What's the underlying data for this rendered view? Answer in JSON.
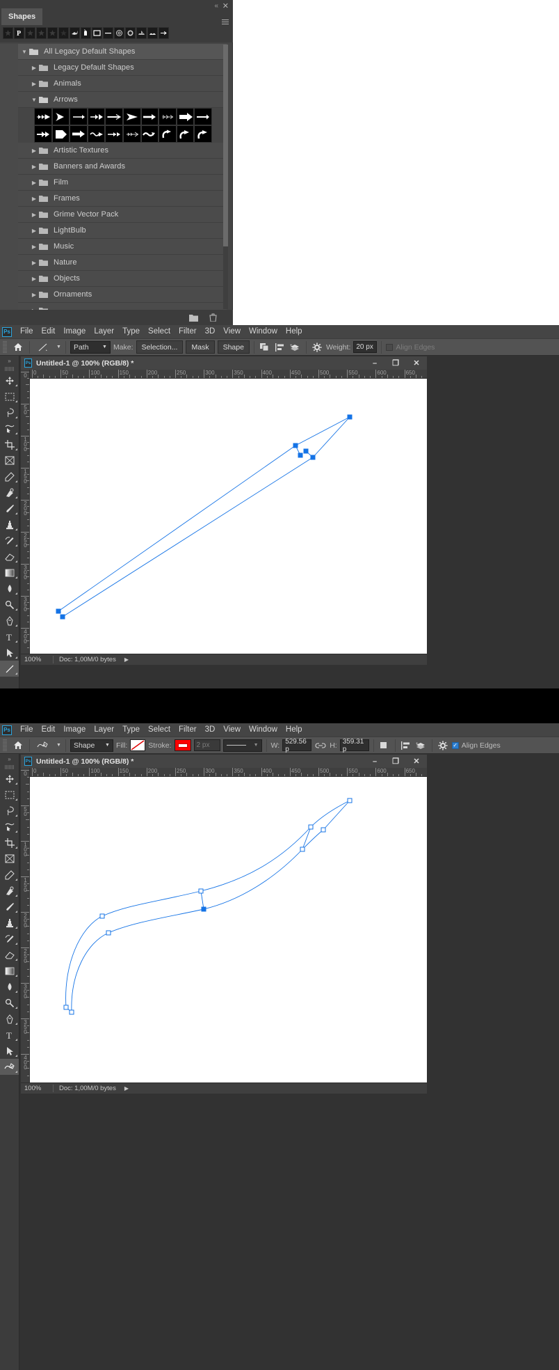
{
  "shapes_panel": {
    "tab_label": "Shapes",
    "close_label": "✕",
    "collapse_label": "«",
    "items": [
      {
        "label": "All Legacy Default Shapes",
        "level": 0,
        "expanded": true
      },
      {
        "label": "Legacy Default Shapes",
        "level": 1,
        "expanded": false
      },
      {
        "label": "Animals",
        "level": 1,
        "expanded": false
      },
      {
        "label": "Arrows",
        "level": 1,
        "expanded": true
      },
      {
        "label": "Artistic Textures",
        "level": 1,
        "expanded": false
      },
      {
        "label": "Banners and Awards",
        "level": 1,
        "expanded": false
      },
      {
        "label": "Film",
        "level": 1,
        "expanded": false
      },
      {
        "label": "Frames",
        "level": 1,
        "expanded": false
      },
      {
        "label": "Grime Vector Pack",
        "level": 1,
        "expanded": false
      },
      {
        "label": "LightBulb",
        "level": 1,
        "expanded": false
      },
      {
        "label": "Music",
        "level": 1,
        "expanded": false
      },
      {
        "label": "Nature",
        "level": 1,
        "expanded": false
      },
      {
        "label": "Objects",
        "level": 1,
        "expanded": false
      },
      {
        "label": "Ornaments",
        "level": 1,
        "expanded": false
      }
    ],
    "footer": {
      "new_group_icon": "new-folder-icon",
      "delete_icon": "trash-icon"
    }
  },
  "window_top": {
    "menus": [
      "File",
      "Edit",
      "Image",
      "Layer",
      "Type",
      "Select",
      "Filter",
      "3D",
      "View",
      "Window",
      "Help"
    ],
    "logo": "Ps",
    "options": {
      "home_icon": "home-icon",
      "tool_icon": "line-tool-icon",
      "mode_value": "Path",
      "make_label": "Make:",
      "selection_label": "Selection...",
      "mask_label": "Mask",
      "shape_label": "Shape",
      "path_ops_icon": "path-operations-icon",
      "align_icon": "path-alignment-icon",
      "arrange_icon": "path-arrangement-icon",
      "gear_icon": "gear-icon",
      "weight_label": "Weight:",
      "weight_value": "20 px",
      "align_edges_label": "Align Edges",
      "align_edges_checked": false
    },
    "document": {
      "title": "Untitled-1 @ 100% (RGB/8) *",
      "minimize": "–",
      "maximize": "❐",
      "close": "✕",
      "zoom": "100%",
      "doc_info": "Doc: 1,00M/0 bytes",
      "ruler_h_labels": [
        "0",
        "50",
        "100",
        "150",
        "200",
        "250",
        "300",
        "350",
        "400",
        "450",
        "500",
        "550",
        "600",
        "650"
      ],
      "ruler_v_labels": [
        "0",
        "50",
        "100",
        "150",
        "200",
        "250",
        "300",
        "350",
        "400"
      ]
    }
  },
  "window_bottom": {
    "menus": [
      "File",
      "Edit",
      "Image",
      "Layer",
      "Type",
      "Select",
      "Filter",
      "3D",
      "View",
      "Window",
      "Help"
    ],
    "logo": "Ps",
    "options": {
      "home_icon": "home-icon",
      "tool_icon": "curvature-pen-tool-icon",
      "mode_value": "Shape",
      "fill_label": "Fill:",
      "fill_swatch": "no-fill-swatch",
      "stroke_label": "Stroke:",
      "stroke_color": "#ff0000",
      "stroke_width_value": "2 px",
      "stroke_style": "solid-line",
      "w_label": "W:",
      "w_value": "529.56 p",
      "link_icon": "link-icon",
      "h_label": "H:",
      "h_value": "359.31 p",
      "path_ops_icon": "path-operations-icon",
      "align_icon": "path-alignment-icon",
      "arrange_icon": "path-arrangement-icon",
      "gear_icon": "gear-icon",
      "align_edges_label": "Align Edges",
      "align_edges_checked": true
    },
    "document": {
      "title": "Untitled-1 @ 100% (RGB/8) *",
      "minimize": "–",
      "maximize": "❐",
      "close": "✕",
      "zoom": "100%",
      "doc_info": "Doc: 1,00M/0 bytes",
      "ruler_h_labels": [
        "0",
        "50",
        "100",
        "150",
        "200",
        "250",
        "300",
        "350",
        "400",
        "450",
        "500",
        "550",
        "600",
        "650"
      ],
      "ruler_v_labels": [
        "0",
        "50",
        "100",
        "150",
        "200",
        "250",
        "300",
        "350",
        "400"
      ]
    }
  },
  "tools": [
    "move-tool",
    "rectangular-marquee-tool",
    "lasso-tool",
    "object-selection-tool",
    "crop-tool",
    "frame-tool",
    "eyedropper-tool",
    "spot-healing-brush-tool",
    "brush-tool",
    "clone-stamp-tool",
    "history-brush-tool",
    "eraser-tool",
    "gradient-tool",
    "blur-tool",
    "dodge-tool",
    "pen-tool",
    "type-tool",
    "path-selection-tool",
    "shape-tool"
  ],
  "colors": {
    "accent_blue": "#1473e6",
    "panel_bg": "#454545",
    "options_bg": "#535353",
    "canvas_bg": "#323232",
    "stroke_red": "#ff0000"
  }
}
